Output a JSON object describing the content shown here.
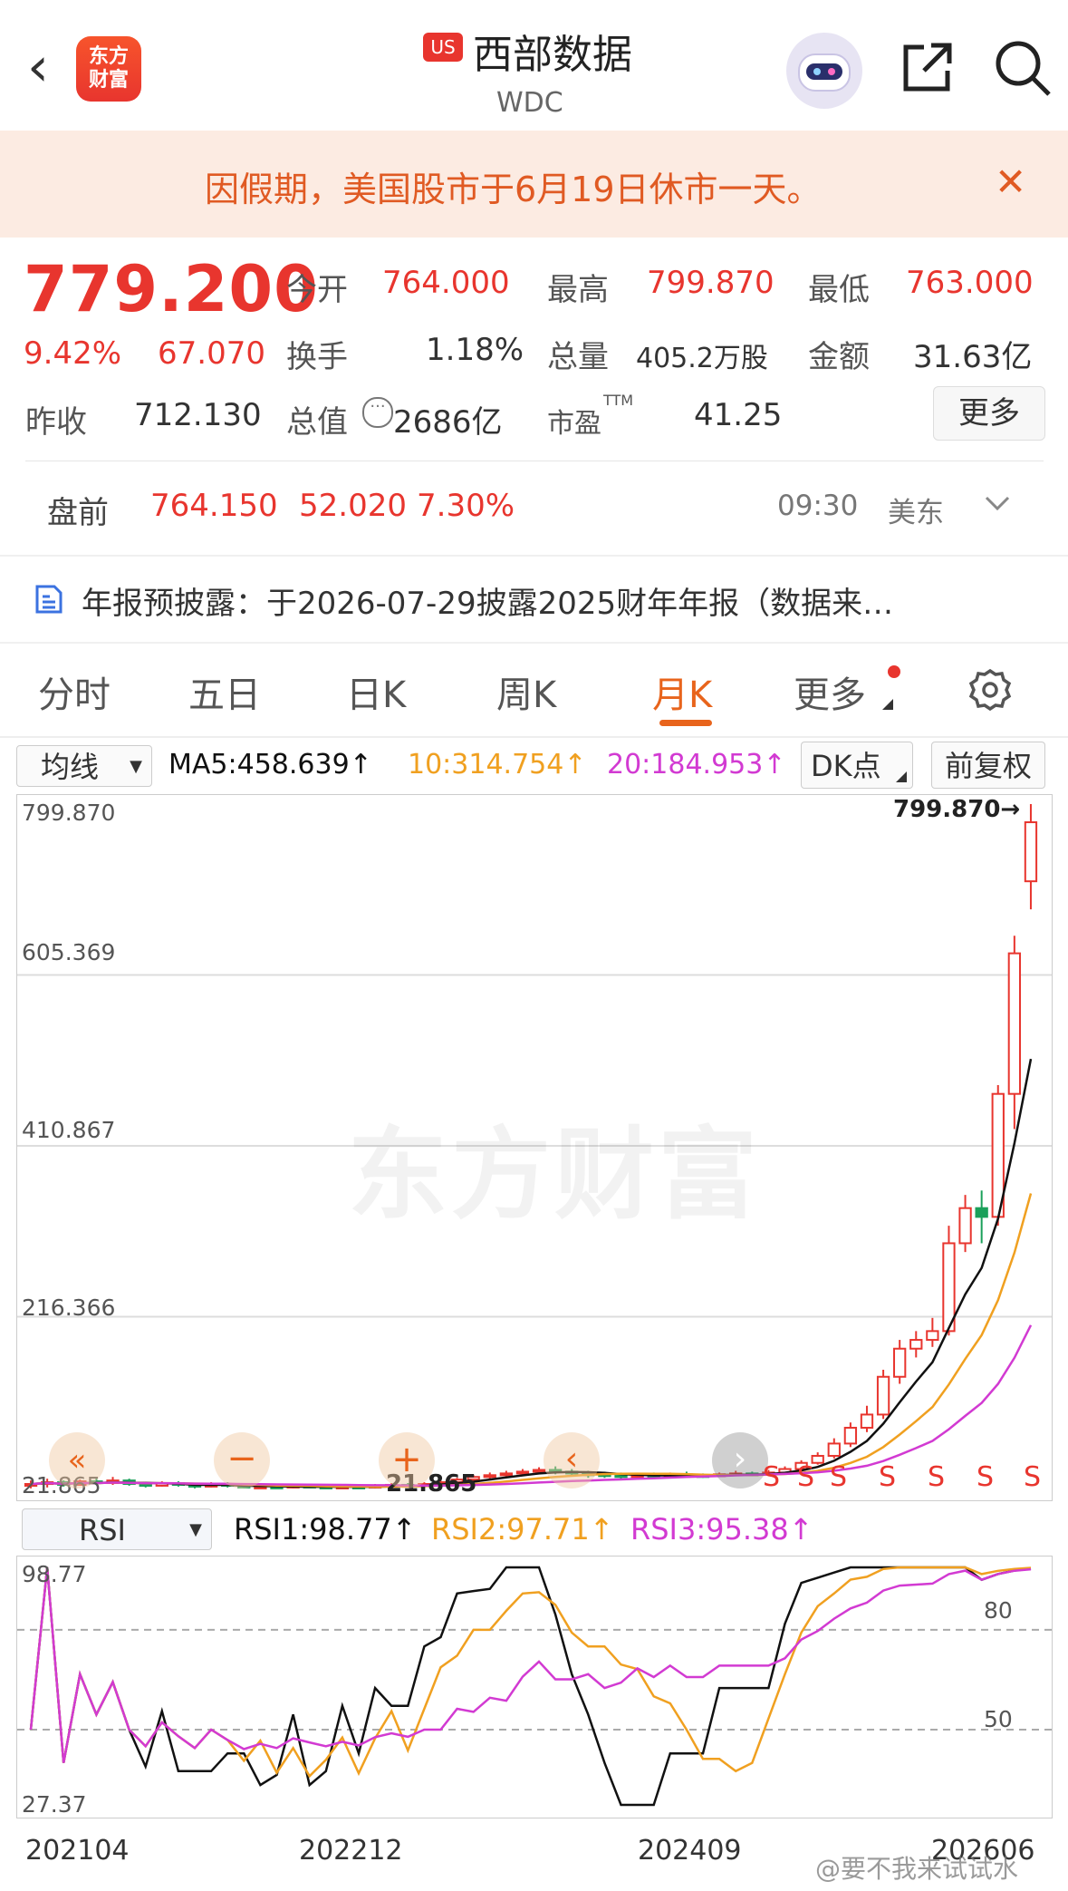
{
  "header": {
    "logo_line1": "东方",
    "logo_line2": "财富",
    "market_badge": "US",
    "stock_name": "西部数据",
    "ticker": "WDC"
  },
  "notice": {
    "text": "因假期，美国股市于6月19日休市一天。",
    "close_icon": "close-icon"
  },
  "quote": {
    "price": "779.200",
    "change_pct": "9.42%",
    "change": "67.070",
    "open_label": "今开",
    "open": "764.000",
    "high_label": "最高",
    "high": "799.870",
    "low_label": "最低",
    "low": "763.000",
    "turnover_label": "换手",
    "turnover": "1.18%",
    "volume_label": "总量",
    "volume": "405.2万股",
    "amount_label": "金额",
    "amount": "31.63亿",
    "prev_close_label": "昨收",
    "prev_close": "712.130",
    "mktcap_label": "总值",
    "mktcap": "2686亿",
    "pe_label": "市盈",
    "pe_sup": "TTM",
    "pe": "41.25",
    "more_button": "更多"
  },
  "premarket": {
    "label": "盘前",
    "price": "764.150",
    "change": "52.020",
    "change_pct": "7.30%",
    "time": "09:30",
    "tz": "美东"
  },
  "report": {
    "text": "年报预披露：于2026-07-29披露2025财年年报（数据来…"
  },
  "tabs": [
    "分时",
    "五日",
    "日K",
    "周K",
    "月K",
    "更多"
  ],
  "active_tab": "月K",
  "ma_bar": {
    "dropdown": "均线",
    "ma5": "MA5:458.639↑",
    "ma10": "10:314.754↑",
    "ma20": "20:184.953↑",
    "dk": "DK点",
    "adjust": "前复权"
  },
  "price_axis": {
    "labels": [
      "799.870",
      "605.369",
      "410.867",
      "216.366",
      "21.865"
    ],
    "max_marker": "799.870→",
    "min_marker": "21.865",
    "watermark": "东方财富",
    "signals": [
      "S",
      "S",
      "S",
      "S",
      "S",
      "S",
      "S",
      "S"
    ]
  },
  "rsi_bar": {
    "dropdown": "RSI",
    "rsi1": "RSI1:98.77↑",
    "rsi2": "RSI2:97.71↑",
    "rsi3": "RSI3:95.38↑"
  },
  "rsi_axis": {
    "top": "98.77",
    "bottom": "27.37",
    "line80": "80",
    "line50": "50"
  },
  "x_axis": [
    "202104",
    "202212",
    "202409",
    "202606"
  ],
  "watermark_bottom": "@要不我来试试水",
  "colors": {
    "up": "#e8352e",
    "down": "#1aa05a",
    "ma5": "#111111",
    "ma10": "#f0a020",
    "ma20": "#d23ad2",
    "accent": "#e8641c"
  },
  "chart_data": {
    "type": "candlestick",
    "y_range": [
      21.865,
      799.87
    ],
    "candles": [
      {
        "o": 24,
        "c": 26,
        "h": 30,
        "l": 21
      },
      {
        "o": 26,
        "c": 28,
        "h": 32,
        "l": 22
      },
      {
        "o": 28,
        "c": 25,
        "h": 30,
        "l": 23
      },
      {
        "o": 25,
        "c": 29,
        "h": 31,
        "l": 24
      },
      {
        "o": 29,
        "c": 27,
        "h": 33,
        "l": 25
      },
      {
        "o": 27,
        "c": 30,
        "h": 34,
        "l": 25
      },
      {
        "o": 30,
        "c": 26,
        "h": 32,
        "l": 24
      },
      {
        "o": 26,
        "c": 24,
        "h": 28,
        "l": 22
      },
      {
        "o": 24,
        "c": 27,
        "h": 29,
        "l": 23
      },
      {
        "o": 27,
        "c": 25,
        "h": 29,
        "l": 23
      },
      {
        "o": 25,
        "c": 23,
        "h": 27,
        "l": 21
      },
      {
        "o": 23,
        "c": 26,
        "h": 28,
        "l": 22
      },
      {
        "o": 26,
        "c": 24,
        "h": 28,
        "l": 22
      },
      {
        "o": 24,
        "c": 22,
        "h": 26,
        "l": 21
      },
      {
        "o": 22,
        "c": 23,
        "h": 25,
        "l": 21
      },
      {
        "o": 23,
        "c": 22,
        "h": 24,
        "l": 21
      },
      {
        "o": 22,
        "c": 24,
        "h": 26,
        "l": 21
      },
      {
        "o": 24,
        "c": 23,
        "h": 26,
        "l": 22
      },
      {
        "o": 23,
        "c": 22,
        "h": 25,
        "l": 21
      },
      {
        "o": 22,
        "c": 23,
        "h": 24,
        "l": 21
      },
      {
        "o": 23,
        "c": 22,
        "h": 24,
        "l": 21
      },
      {
        "o": 22,
        "c": 24,
        "h": 26,
        "l": 21
      },
      {
        "o": 24,
        "c": 25,
        "h": 27,
        "l": 22
      },
      {
        "o": 25,
        "c": 24,
        "h": 27,
        "l": 23
      },
      {
        "o": 24,
        "c": 26,
        "h": 28,
        "l": 23
      },
      {
        "o": 26,
        "c": 28,
        "h": 30,
        "l": 24
      },
      {
        "o": 28,
        "c": 31,
        "h": 33,
        "l": 26
      },
      {
        "o": 31,
        "c": 34,
        "h": 36,
        "l": 29
      },
      {
        "o": 34,
        "c": 36,
        "h": 39,
        "l": 32
      },
      {
        "o": 36,
        "c": 38,
        "h": 41,
        "l": 33
      },
      {
        "o": 38,
        "c": 40,
        "h": 43,
        "l": 35
      },
      {
        "o": 40,
        "c": 42,
        "h": 45,
        "l": 37
      },
      {
        "o": 42,
        "c": 40,
        "h": 46,
        "l": 37
      },
      {
        "o": 40,
        "c": 38,
        "h": 43,
        "l": 35
      },
      {
        "o": 38,
        "c": 37,
        "h": 41,
        "l": 33
      },
      {
        "o": 37,
        "c": 36,
        "h": 40,
        "l": 33
      },
      {
        "o": 36,
        "c": 35,
        "h": 39,
        "l": 32
      },
      {
        "o": 35,
        "c": 36,
        "h": 38,
        "l": 32
      },
      {
        "o": 36,
        "c": 35,
        "h": 39,
        "l": 33
      },
      {
        "o": 35,
        "c": 37,
        "h": 39,
        "l": 33
      },
      {
        "o": 37,
        "c": 36,
        "h": 40,
        "l": 34
      },
      {
        "o": 36,
        "c": 35,
        "h": 38,
        "l": 33
      },
      {
        "o": 35,
        "c": 37,
        "h": 39,
        "l": 34
      },
      {
        "o": 37,
        "c": 38,
        "h": 41,
        "l": 35
      },
      {
        "o": 38,
        "c": 37,
        "h": 40,
        "l": 35
      },
      {
        "o": 37,
        "c": 39,
        "h": 42,
        "l": 35
      },
      {
        "o": 39,
        "c": 43,
        "h": 46,
        "l": 37
      },
      {
        "o": 43,
        "c": 50,
        "h": 53,
        "l": 41
      },
      {
        "o": 50,
        "c": 58,
        "h": 62,
        "l": 48
      },
      {
        "o": 58,
        "c": 72,
        "h": 78,
        "l": 55
      },
      {
        "o": 72,
        "c": 90,
        "h": 96,
        "l": 68
      },
      {
        "o": 90,
        "c": 105,
        "h": 115,
        "l": 85
      },
      {
        "o": 105,
        "c": 148,
        "h": 156,
        "l": 100
      },
      {
        "o": 148,
        "c": 180,
        "h": 190,
        "l": 140
      },
      {
        "o": 180,
        "c": 190,
        "h": 200,
        "l": 170
      },
      {
        "o": 190,
        "c": 200,
        "h": 215,
        "l": 182
      },
      {
        "o": 200,
        "c": 300,
        "h": 320,
        "l": 195
      },
      {
        "o": 300,
        "c": 340,
        "h": 355,
        "l": 290
      },
      {
        "o": 340,
        "c": 330,
        "h": 360,
        "l": 300
      },
      {
        "o": 330,
        "c": 470,
        "h": 480,
        "l": 320
      },
      {
        "o": 470,
        "c": 630,
        "h": 650,
        "l": 430
      },
      {
        "o": 712,
        "c": 779.2,
        "h": 799.87,
        "l": 680
      }
    ],
    "ma5": [
      458.639
    ],
    "ma10": [
      314.754
    ],
    "ma20": [
      184.953
    ],
    "rsi": {
      "rsi1": 98.77,
      "rsi2": 97.71,
      "rsi3": 95.38,
      "range": [
        27.37,
        98.77
      ],
      "ref_lines": [
        80,
        50
      ]
    }
  }
}
